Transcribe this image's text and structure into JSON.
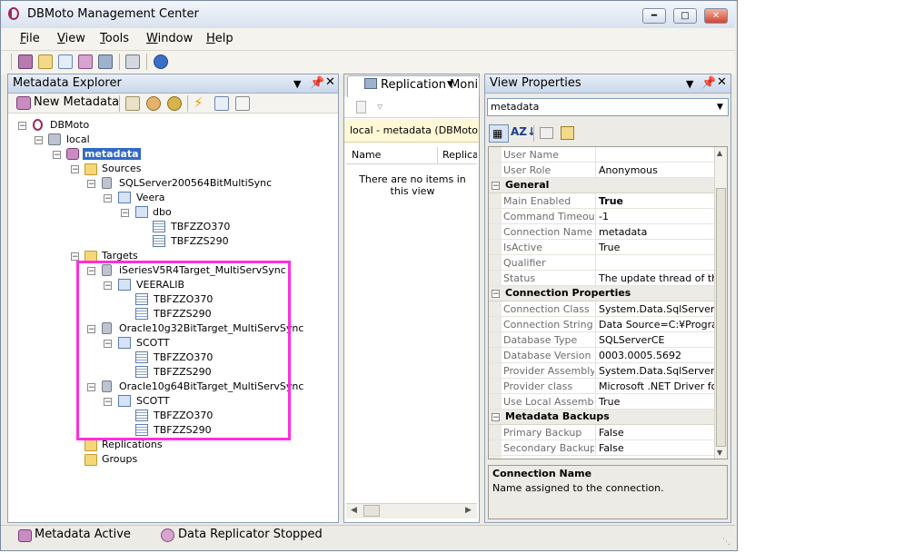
{
  "window": {
    "title": "DBMoto Management Center"
  },
  "menu": {
    "items": [
      {
        "label": "File",
        "accel": "F",
        "rest": "ile"
      },
      {
        "label": "View",
        "accel": "V",
        "rest": "iew"
      },
      {
        "label": "Tools",
        "accel": "T",
        "rest": "ools"
      },
      {
        "label": "Window",
        "accel": "W",
        "rest": "indow"
      },
      {
        "label": "Help",
        "accel": "H",
        "rest": "elp"
      }
    ]
  },
  "explorer": {
    "title": "Metadata Explorer",
    "new_metadata_label": "New Metadata",
    "tree": {
      "root": "DBMoto",
      "local": "local",
      "metadata": "metadata",
      "sources": "Sources",
      "source_server": "SQLServer200564BitMultiSync",
      "source_db": "Veera",
      "source_schema": "dbo",
      "source_tables": [
        "TBFZZO370",
        "TBFZZS290"
      ],
      "targets": "Targets",
      "target_servers": [
        {
          "name": "iSeriesV5R4Target_MultiServSync",
          "schema": "VEERALIB",
          "tables": [
            "TBFZZO370",
            "TBFZZS290"
          ]
        },
        {
          "name": "Oracle10g32BitTarget_MultiServSync",
          "schema": "SCOTT",
          "tables": [
            "TBFZZO370",
            "TBFZZS290"
          ]
        },
        {
          "name": "Oracle10g64BitTarget_MultiServSync",
          "schema": "SCOTT",
          "tables": [
            "TBFZZO370",
            "TBFZZS290"
          ]
        }
      ],
      "replications": "Replications",
      "groups": "Groups"
    },
    "highlight_color": "#ff2ee0"
  },
  "monitor": {
    "tab_label": "Replication Monit",
    "path_text": "local - metadata (DBMoto¥loc",
    "columns": [
      "Name",
      "Replica"
    ],
    "empty_text": "There are no items in this view"
  },
  "properties": {
    "title": "View Properties",
    "selected_object": "metadata",
    "rows_top": [
      {
        "name": "User Name",
        "value": ""
      },
      {
        "name": "User Role",
        "value": "Anonymous"
      }
    ],
    "categories": [
      {
        "name": "General",
        "rows": [
          {
            "name": "Main Enabled",
            "value": "True",
            "bold": true
          },
          {
            "name": "Command Timeout",
            "value": "-1"
          },
          {
            "name": "Connection Name",
            "value": "metadata"
          },
          {
            "name": "IsActive",
            "value": "True"
          },
          {
            "name": "Qualifier",
            "value": ""
          },
          {
            "name": "Status",
            "value": "The update thread of the l"
          }
        ]
      },
      {
        "name": "Connection Properties",
        "rows": [
          {
            "name": "Connection Class",
            "value": "System.Data.SqlServerCe"
          },
          {
            "name": "Connection String",
            "value": "Data Source=C:¥Program"
          },
          {
            "name": "Database Type",
            "value": "SQLServerCE"
          },
          {
            "name": "Database Version",
            "value": "0003.0005.5692"
          },
          {
            "name": "Provider Assembly",
            "value": "System.Data.SqlServerCe"
          },
          {
            "name": "Provider class",
            "value": "Microsoft .NET Driver for S"
          },
          {
            "name": "Use Local Assembly",
            "value": "True"
          }
        ]
      },
      {
        "name": "Metadata Backups",
        "rows": [
          {
            "name": "Primary Backup",
            "value": "False"
          },
          {
            "name": "Secondary Backup",
            "value": "False"
          }
        ]
      }
    ],
    "description_title": "Connection Name",
    "description_text": "Name assigned to the connection."
  },
  "status": {
    "metadata": "Metadata Active",
    "replicator": "Data Replicator Stopped"
  }
}
